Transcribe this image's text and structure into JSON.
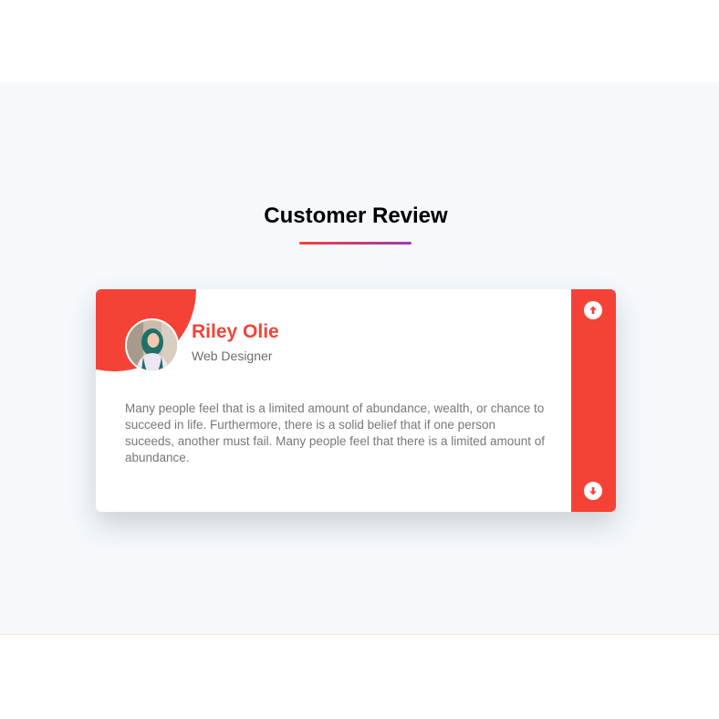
{
  "section": {
    "title": "Customer Review"
  },
  "review": {
    "name": "Riley Olie",
    "role": "Web Designer",
    "text": "Many people feel that is a limited amount of abundance, wealth, or chance to succeed in life. Furthermore, there is a solid belief that if one person suceeds, another must fail. Many people feel that there is a limited amount of abundance."
  },
  "controls": {
    "up_icon": "arrow-up-circle-icon",
    "down_icon": "arrow-down-circle-icon"
  },
  "colors": {
    "accent": "#f44336",
    "gradient_end": "#9c3aaf",
    "background": "#f5f9fc"
  }
}
